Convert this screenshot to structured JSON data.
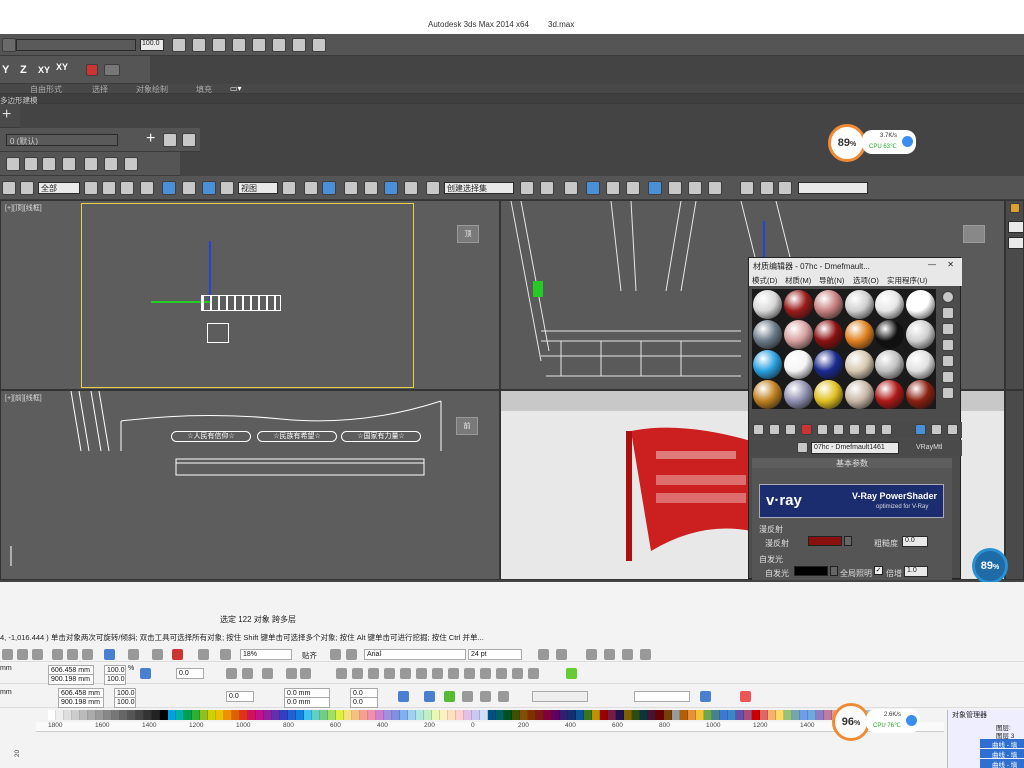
{
  "max_window": {
    "title_app": "Autodesk 3ds Max  2014 x64",
    "title_file": "3d.max"
  },
  "max_toolbar": {
    "spinner_value": "100.0",
    "axis_y": "Y",
    "axis_z": "Z",
    "axis_xy": "XY",
    "axis_xy2": "XY",
    "ribbon_tabs": [
      "自由形式",
      "选择",
      "对象绘制",
      "填充"
    ],
    "panel_label": "多边形建模",
    "layer_dropdown": "0 (默认)",
    "filter_dropdown": "全部",
    "ref_coord_dropdown": "视图",
    "selection_set_dropdown": "创建选择集"
  },
  "viewports": {
    "top_left_label": "[+][顶][线框]",
    "bottom_left_label": "[+][前][线框]",
    "bottom_left_banners": [
      "☆人民有信仰☆",
      "☆民族有希望☆",
      "☆国家有力量☆"
    ],
    "viewcube_tl": "顶",
    "viewcube_bl": "前"
  },
  "material_editor": {
    "title": "材质编辑器 - 07hc - Dmefmault...",
    "menu": [
      "模式(D)",
      "材质(M)",
      "导航(N)",
      "选项(O)",
      "实用程序(U)"
    ],
    "material_name": "07hc - Dmefmault1461",
    "material_type": "VRayMtl",
    "rollout_title": "基本参数",
    "banner_logo": "v·ray",
    "banner_title": "V-Ray PowerShader",
    "banner_subtitle": "optimized for V-Ray",
    "diffuse_group": "漫反射",
    "diffuse_label": "漫反射",
    "roughness_label": "粗糙度",
    "roughness_value": "0.0",
    "self_illum_group": "自发光",
    "self_illum_label": "自发光",
    "gi_label": "全局照明",
    "multiplier_label": "倍增",
    "multiplier_value": "1.0",
    "colors": {
      "diffuse": "#8a1010",
      "self_illum": "#000000"
    },
    "slot_colors": [
      "#d8d8d8",
      "#9a1a1a",
      "#c88080",
      "#d0d0d0",
      "#e6e6e6",
      "#ffffff",
      "#6a7a88",
      "#d8a0a0",
      "#8a1010",
      "#e08020",
      "#101010",
      "#d0d0d0",
      "#2aa0e0",
      "#f4f4f4",
      "#1a2a90",
      "#d8c8b0",
      "#c0c0c0",
      "#e0e0e0",
      "#c08020",
      "#9090b0",
      "#e0c020",
      "#c8b8a8",
      "#b01818",
      "#8a2010"
    ]
  },
  "perf_monitors": {
    "top": {
      "percent": "89",
      "unit": "%",
      "net": "3.7K/s",
      "cpu": "CPU 63℃"
    },
    "right": {
      "percent": "89",
      "unit": "%"
    },
    "bottom": {
      "percent": "96",
      "unit": "%",
      "net": "2.6K/s",
      "cpu": "CPU 76℃"
    }
  },
  "coreldraw": {
    "status_select": "选定 122 对象 跨多层",
    "status_hint": "4, -1,016.444 ) 单击对象两次可旋转/倾斜; 双击工具可选择所有对象; 按住 Shift 键单击可选择多个对象; 按住 Alt 键单击可进行挖掘; 按住 Ctrl 并单...",
    "zoom": "18%",
    "snap": "贴齐",
    "font_name": "Arial",
    "font_size": "24 pt",
    "width_a": "606.458 mm",
    "height_a": "900.198 mm",
    "scale_a1": "100.0",
    "scale_a2": "100.0",
    "pct": "%",
    "rot": "0.0",
    "width_b": "606.458 mm",
    "height_b": "900.198 mm",
    "scale_b1": "100.0",
    "scale_b2": "100.0",
    "rot_b": "0.0",
    "pos_b1": "0.0 mm",
    "pos_b2": "0.0 mm",
    "skew1": "0.0",
    "skew2": "0.0",
    "mm_label": "mm",
    "ruler_ticks": [
      "1800",
      "1600",
      "1400",
      "1200",
      "1000",
      "800",
      "600",
      "400",
      "200",
      "0",
      "200",
      "400",
      "600",
      "800",
      "1000",
      "1200",
      "1400"
    ],
    "ruler_v": "20",
    "object_manager_title": "对象管理器",
    "layer_label": "图层:",
    "layer3": "图层 3",
    "obj_rows": [
      "曲线 - 填",
      "曲线 - 填",
      "曲线 - 填"
    ],
    "palette": [
      "#ffffff",
      "#eeeeee",
      "#dddddd",
      "#cccccc",
      "#bbbbbb",
      "#aaaaaa",
      "#999999",
      "#888888",
      "#777777",
      "#666666",
      "#555555",
      "#444444",
      "#333333",
      "#222222",
      "#000000",
      "#00a0e0",
      "#00b0a0",
      "#00a050",
      "#30b030",
      "#90c020",
      "#d0d000",
      "#f0c000",
      "#f09000",
      "#e06000",
      "#e03020",
      "#d01060",
      "#c01090",
      "#9020a0",
      "#6030b0",
      "#3040c0",
      "#2060d0",
      "#1080e0",
      "#40c0f0",
      "#60d0c0",
      "#70d080",
      "#a0e060",
      "#e0f040",
      "#f8e080",
      "#f8c080",
      "#f8a090",
      "#f090b0",
      "#d080d0",
      "#a090e0",
      "#8090e0",
      "#80b0f0",
      "#a0d0f0",
      "#b0e8e0",
      "#c0f0c0",
      "#e8f8b0",
      "#fff0c0",
      "#ffe0c0",
      "#ffd0d0",
      "#e0c0e8",
      "#c8c8f0",
      "#d0e0f8",
      "#005080",
      "#006060",
      "#005020",
      "#405000",
      "#805000",
      "#803000",
      "#801818",
      "#800040",
      "#600060",
      "#302070",
      "#103070",
      "#0b5394",
      "#38761d",
      "#bf9000",
      "#990000",
      "#741b47",
      "#20124d",
      "#7f6000",
      "#274e13",
      "#0c343d",
      "#4c1130",
      "#660000",
      "#783f04",
      "#999999",
      "#b45f06",
      "#e69138",
      "#f1c232",
      "#6aa84f",
      "#45818e",
      "#3c78d8",
      "#3d85c6",
      "#674ea7",
      "#a64d79",
      "#cc0000",
      "#e06666",
      "#f6b26b",
      "#ffd966",
      "#93c47d",
      "#76a5af",
      "#6d9eeb",
      "#6fa8dc",
      "#8e7cc3",
      "#c27ba0",
      "#ea9999",
      "#f9cb9c",
      "#ffe599",
      "#b6d7a8",
      "#a2c4c9",
      "#a4c2f4",
      "#9fc5e8",
      "#b4a7d6",
      "#d5a6bd"
    ]
  }
}
